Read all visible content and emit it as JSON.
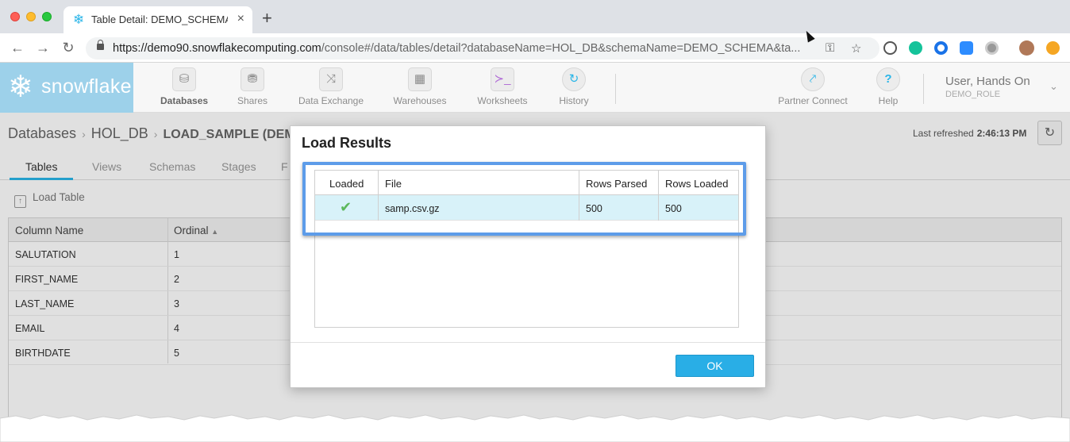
{
  "browser": {
    "tab_title": "Table Detail: DEMO_SCHEMA.L",
    "tab_close": "×",
    "new_tab": "+",
    "url_host": "https://demo90.snowflakecomputing.com",
    "url_path": "/console#/data/tables/detail?databaseName=HOL_DB&schemaName=DEMO_SCHEMA&ta...",
    "back": "←",
    "forward": "→",
    "reload": "↻"
  },
  "app": {
    "logo_text": "snowflake",
    "nav": [
      {
        "label": "Databases",
        "icon": "database-icon",
        "active": true
      },
      {
        "label": "Shares",
        "icon": "shares-icon"
      },
      {
        "label": "Data Exchange",
        "icon": "data-exchange-icon"
      },
      {
        "label": "Warehouses",
        "icon": "warehouses-icon"
      },
      {
        "label": "Worksheets",
        "icon": "worksheets-icon"
      },
      {
        "label": "History",
        "icon": "history-icon"
      },
      {
        "label": "Partner Connect",
        "icon": "partner-connect-icon"
      },
      {
        "label": "Help",
        "icon": "help-icon"
      }
    ],
    "user_name": "User, Hands On",
    "user_role": "DEMO_ROLE"
  },
  "page": {
    "breadcrumb": [
      "Databases",
      "HOL_DB",
      "LOAD_SAMPLE (DEM"
    ],
    "last_refreshed_label": "Last refreshed",
    "last_refreshed_time": "2:46:13 PM",
    "tabs": [
      "Tables",
      "Views",
      "Schemas",
      "Stages",
      "F"
    ],
    "load_table": "Load Table",
    "columns_header": [
      "Column Name",
      "Ordinal"
    ],
    "sort_indicator": "▲",
    "rows": [
      [
        "SALUTATION",
        "1"
      ],
      [
        "FIRST_NAME",
        "2"
      ],
      [
        "LAST_NAME",
        "3"
      ],
      [
        "EMAIL",
        "4"
      ],
      [
        "BIRTHDATE",
        "5"
      ]
    ]
  },
  "modal": {
    "title": "Load Results",
    "headers": [
      "Loaded",
      "File",
      "Rows Parsed",
      "Rows Loaded"
    ],
    "row": {
      "loaded": "✔",
      "file": "samp.csv.gz",
      "rows_parsed": "500",
      "rows_loaded": "500"
    },
    "ok_label": "OK"
  },
  "colors": {
    "accent": "#29b5e8",
    "logo_bg": "#9dd1ea",
    "highlight": "#5d9ce9",
    "row_selected": "#d8f2f9"
  }
}
